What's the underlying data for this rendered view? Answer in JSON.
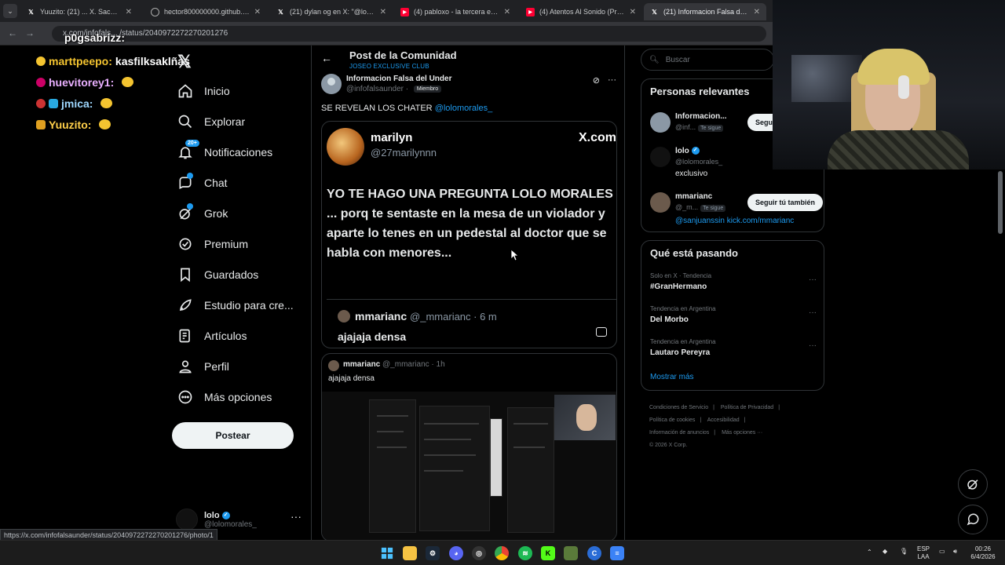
{
  "browser": {
    "tabs": [
      {
        "title": "Yuuzito: (21) ... X. Saca la noche",
        "icon": "x-icon"
      },
      {
        "title": "hector800000000.github.io/test",
        "icon": "globe-icon"
      },
      {
        "title": "(21) dylan og en X: \"@lolomora...",
        "icon": "x-icon"
      },
      {
        "title": "(4) pabloxo - la tercera es la vencida",
        "icon": "youtube-icon"
      },
      {
        "title": "(4) Atentos Al Sonido (Prod. Ela...",
        "icon": "youtube-icon"
      },
      {
        "title": "(21) Informacion Falsa del Under",
        "icon": "x-icon"
      }
    ],
    "url": "x.com/infofals... /status/2040972272270201276",
    "status_url": "https://x.com/infofalsaunder/status/2040972272270201276/photo/1"
  },
  "stream_chat": [
    {
      "user": "p0gsabrizz:",
      "color": "#ffffff"
    },
    {
      "user": "marttpeepo:",
      "message": "kasfilksaklñas",
      "color": "#f4c430"
    },
    {
      "user": "huevitorey1:",
      "color": "#e9b0ff"
    },
    {
      "user": "jmica:",
      "color": "#9fd8ff"
    },
    {
      "user": "Yuuzito:",
      "color": "#ffd04a"
    }
  ],
  "nav": {
    "items": [
      {
        "label": "Inicio",
        "icon": "home-icon"
      },
      {
        "label": "Explorar",
        "icon": "search-icon"
      },
      {
        "label": "Notificaciones",
        "icon": "bell-icon",
        "badge": "20+"
      },
      {
        "label": "Chat",
        "icon": "chat-icon",
        "dot": true
      },
      {
        "label": "Grok",
        "icon": "grok-icon",
        "dot": true
      },
      {
        "label": "Premium",
        "icon": "premium-icon"
      },
      {
        "label": "Guardados",
        "icon": "bookmark-icon"
      },
      {
        "label": "Estudio para cre...",
        "icon": "rocket-icon"
      },
      {
        "label": "Artículos",
        "icon": "article-icon"
      },
      {
        "label": "Perfil",
        "icon": "person-icon"
      },
      {
        "label": "Más opciones",
        "icon": "more-circle-icon"
      }
    ],
    "post_button": "Postear",
    "account": {
      "name": "lolo",
      "handle": "@lolomorales_"
    }
  },
  "main": {
    "title": "Post de la Comunidad",
    "subtitle": "JOSEO EXCLUSIVE CLUB",
    "post": {
      "author": "Informacion Falsa del Under",
      "handle": "@infofalsaunder",
      "member_badge": "Miembro",
      "text": "SE REVELAN LOS CHATER",
      "mention": "@lolomorales_",
      "media": {
        "name": "marilyn",
        "handle": "@27marilynnn",
        "site": "X.com",
        "question": "YO TE HAGO UNA PREGUNTA LOLO MORALES ... porq te sentaste en la mesa de un violador y aparte lo tenes en un pedestal al doctor que se habla con menores...",
        "reply_name": "mmarianc",
        "reply_meta": "@_mmarianc · 6 m",
        "reply_text": "ajajaja densa"
      }
    },
    "reply": {
      "name": "mmarianc",
      "meta": "@_mmarianc · 1h",
      "text": "ajajaja densa"
    }
  },
  "right": {
    "search_placeholder": "Buscar",
    "relevant_title": "Personas relevantes",
    "people": [
      {
        "name": "Informacion...",
        "handle": "@inf...",
        "follows_you": "Te sigue",
        "button": "Seguir tú también",
        "bio": ""
      },
      {
        "name": "lolo",
        "handle": "@lolomorales_",
        "follows_you": "",
        "button": "",
        "bio": "exclusivo"
      },
      {
        "name": "mmarianc",
        "handle": "@_m...",
        "follows_you": "Te sigue",
        "button": "Seguir tú también",
        "bio": "@sanjuanssin kick.com/mmarianc"
      }
    ],
    "trends_title": "Qué está pasando",
    "trends": [
      {
        "context": "Solo en X · Tendencia",
        "name": "#GranHermano"
      },
      {
        "context": "Tendencia en Argentina",
        "name": "Del Morbo"
      },
      {
        "context": "Tendencia en Argentina",
        "name": "Lautaro Pereyra"
      }
    ],
    "show_more": "Mostrar más",
    "footer": [
      "Condiciones de Servicio",
      "|",
      "Política de Privacidad",
      "|",
      "Política de cookies",
      "|",
      "Accesibilidad",
      "|",
      "Información de anuncios",
      "|",
      "Más opciones ···",
      "© 2026 X Corp."
    ]
  },
  "taskbar": {
    "lang": "ESP",
    "layout": "LAA",
    "time": "00:26",
    "date": "6/4/2026"
  }
}
